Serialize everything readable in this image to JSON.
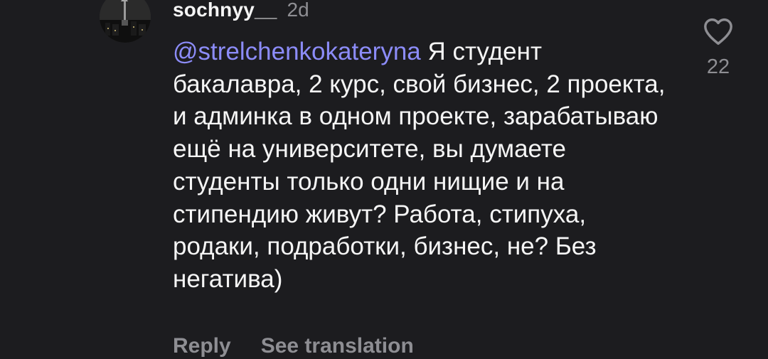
{
  "comment": {
    "username": "sochnyy__",
    "timestamp": "2d",
    "mention": "@strelchenkokateryna",
    "text": "Я студент бакалавра, 2 курс, свой бизнес, 2 проекта, и админка в одном проекте, зарабатываю ещё на университете, вы думаете студенты только одни нищие и на стипендию живут? Работа, стипуха, родаки, подработки, бизнес, не? Без негатива)",
    "avatar_icon": "city-night-avatar",
    "actions": {
      "reply": "Reply",
      "translate": "See translation"
    },
    "like": {
      "icon": "heart-outline-icon",
      "count": "22"
    }
  },
  "colors": {
    "background": "#1c1c1f",
    "text": "#f5f5f5",
    "mention": "#8c8cf8",
    "muted": "#8e8e93"
  }
}
